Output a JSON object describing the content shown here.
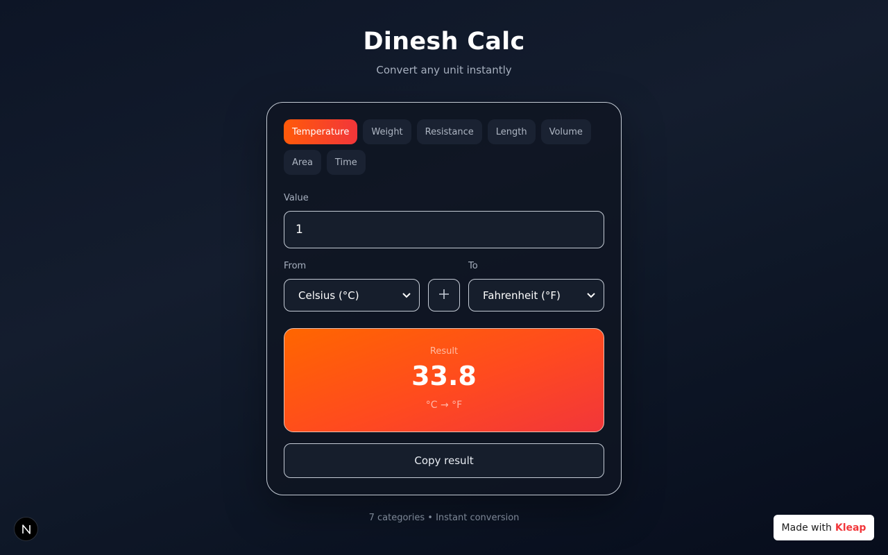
{
  "header": {
    "title": "Dinesh Calc",
    "subtitle": "Convert any unit instantly"
  },
  "tabs": [
    {
      "label": "Temperature",
      "active": true
    },
    {
      "label": "Weight",
      "active": false
    },
    {
      "label": "Resistance",
      "active": false
    },
    {
      "label": "Length",
      "active": false
    },
    {
      "label": "Volume",
      "active": false
    },
    {
      "label": "Area",
      "active": false
    },
    {
      "label": "Time",
      "active": false
    }
  ],
  "form": {
    "value_label": "Value",
    "value": "1",
    "from_label": "From",
    "from_selected": "Celsius (°C)",
    "to_label": "To",
    "to_selected": "Fahrenheit (°F)",
    "swap_icon": "plus-icon"
  },
  "result": {
    "label": "Result",
    "value": "33.8",
    "units": "°C → °F"
  },
  "copy_label": "Copy result",
  "footer": "7 categories • Instant conversion",
  "corner_logo": "N",
  "badge": {
    "prefix": "Made with",
    "brand": "Kleap"
  },
  "colors": {
    "accent_start": "#ff5a0a",
    "accent_end": "#f2363a",
    "background": "#0d1526",
    "panel": "#161e2c"
  }
}
